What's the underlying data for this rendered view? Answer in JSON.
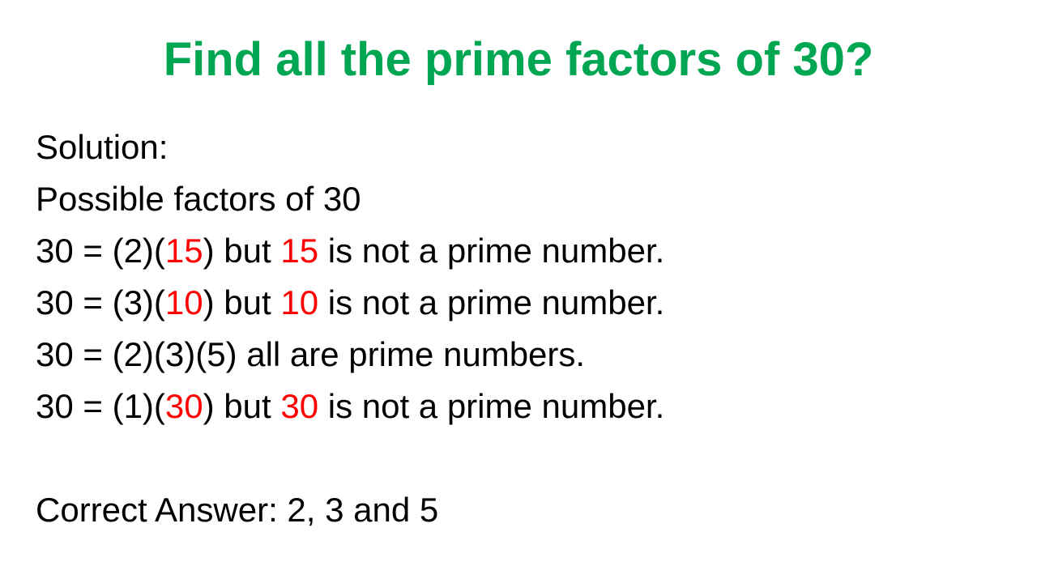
{
  "colors": {
    "title": "#00A651",
    "highlight": "#FF0000",
    "text": "#000000",
    "background": "#FFFFFF"
  },
  "title": "Find all the prime factors of 30?",
  "solution_label": "Solution:",
  "intro": "Possible factors of 30",
  "rows": [
    {
      "pre": "30 = (2)(",
      "hl1": "15",
      "mid": ") but ",
      "hl2": "15",
      "post": " is not a prime number."
    },
    {
      "pre": "30 = (3)(",
      "hl1": "10",
      "mid": ") but ",
      "hl2": "10",
      "post": " is not a prime number."
    },
    {
      "plain": "30 = (2)(3)(5) all are prime numbers."
    },
    {
      "pre": "30 = (1)(",
      "hl1": "30",
      "mid": ") but ",
      "hl2": "30",
      "post": " is not a prime number."
    }
  ],
  "answer": "Correct Answer: 2, 3 and 5"
}
